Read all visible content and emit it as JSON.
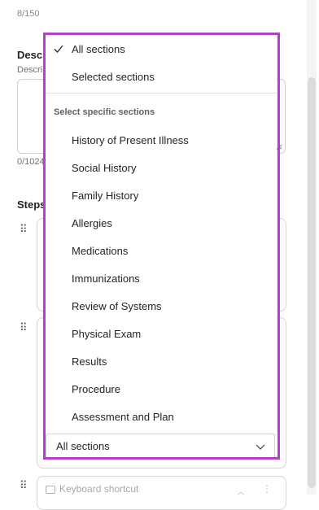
{
  "form": {
    "title_char_count": "8/150",
    "description_title": "Desc",
    "description_sub": "Descri",
    "description_count": "0/1024",
    "steps_title": "Steps",
    "card3_text": "Keyboard shortcut"
  },
  "select": {
    "value": "All sections"
  },
  "dropdown": {
    "options_top": [
      {
        "label": "All sections",
        "checked": true
      },
      {
        "label": "Selected sections",
        "checked": false
      }
    ],
    "group_header": "Select specific sections",
    "sections": [
      "History of Present Illness",
      "Social History",
      "Family History",
      "Allergies",
      "Medications",
      "Immunizations",
      "Review of Systems",
      "Physical Exam",
      "Results",
      "Procedure",
      "Assessment and Plan"
    ]
  },
  "colors": {
    "highlight": "#b540c8",
    "focus_underline": "#0f6cbd"
  }
}
